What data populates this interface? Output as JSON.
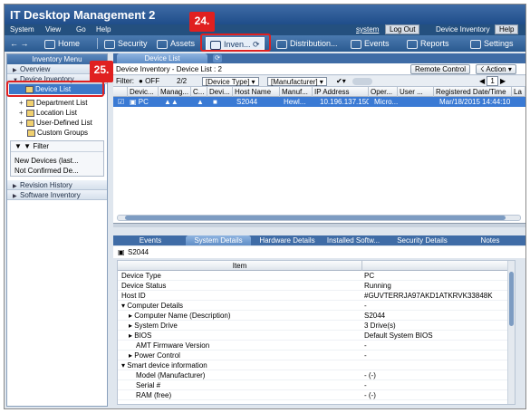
{
  "window": {
    "title": "IT Desktop Management 2"
  },
  "menu": {
    "items": [
      "System",
      "View",
      "Go",
      "Help"
    ],
    "user": "system",
    "logout": "Log Out",
    "section": "Device Inventory",
    "help": "Help"
  },
  "nav": {
    "home": "Home",
    "security": "Security",
    "assets": "Assets",
    "inventory": "Inven...",
    "distribution": "Distribution...",
    "events": "Events",
    "reports": "Reports",
    "settings": "Settings"
  },
  "left": {
    "header": "Inventory Menu",
    "overview": "Overview",
    "device_inventory": "Device Inventory",
    "device_list": "Device List",
    "department_list": "Department List",
    "location_list": "Location List",
    "user_defined_list": "User-Defined List",
    "custom_groups": "Custom Groups",
    "filter": "Filter",
    "filter_items": [
      "New Devices (last...",
      "Not Confirmed De..."
    ],
    "revision_history": "Revision History",
    "software_inventory": "Software Inventory"
  },
  "main": {
    "tab": "Device List",
    "breadcrumb": "Device Inventory - Device List : 2",
    "remote_control": "Remote Control",
    "action": "Action",
    "filter_label": "Filter:",
    "filter_state": "OFF",
    "filter_count": "2/2",
    "device_type": "[Device Type]",
    "manufacturer": "[Manufacturer]",
    "page": "1",
    "columns": [
      "Devic...",
      "Manag...",
      "C...",
      "Devi...",
      "Host Name",
      "Manuf...",
      "IP Address",
      "Oper...",
      "User ...",
      "Registered Date/Time",
      "La"
    ],
    "row": {
      "device": "PC",
      "host": "S2044",
      "manufacturer": "Hewl...",
      "ip": "10.196.137.150",
      "os": "Micro...",
      "registered": "Mar/18/2015 14:44:10"
    }
  },
  "details": {
    "tabs": [
      "Events",
      "System Details",
      "Hardware Details",
      "Installed Softw...",
      "Security Details",
      "Notes"
    ],
    "host": "S2044",
    "column_header": "Item",
    "rows": [
      {
        "k": "Device Type",
        "v": "PC"
      },
      {
        "k": "Device Status",
        "v": "Running"
      },
      {
        "k": "Host ID",
        "v": "#GUVTERRJA97AKD1ATKRVK33848K"
      },
      {
        "k": "Computer Details",
        "v": "-"
      },
      {
        "k": "Computer Name (Description)",
        "v": "S2044"
      },
      {
        "k": "System Drive",
        "v": "3 Drive(s)"
      },
      {
        "k": "BIOS",
        "v": "Default System BIOS"
      },
      {
        "k": "AMT Firmware Version",
        "v": "-"
      },
      {
        "k": "Power Control",
        "v": "-"
      },
      {
        "k": "Smart device information",
        "v": ""
      },
      {
        "k": "Model (Manufacturer)",
        "v": "- (-)"
      },
      {
        "k": "Serial #",
        "v": "-"
      },
      {
        "k": "RAM (free)",
        "v": "- (-)"
      }
    ]
  },
  "callouts": {
    "a": "24.",
    "b": "25."
  }
}
